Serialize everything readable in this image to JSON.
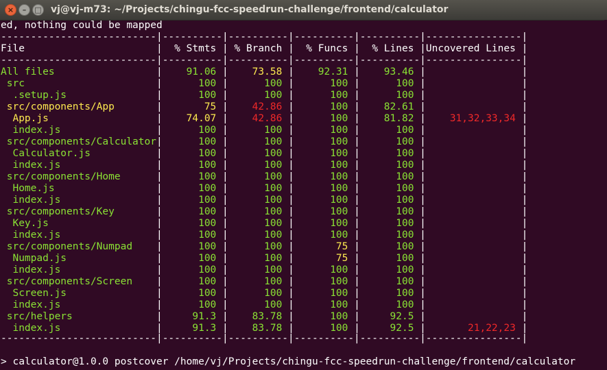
{
  "window": {
    "title": "vj@vj-m73: ~/Projects/chingu-fcc-speedrun-challenge/frontend/calculator",
    "buttons": {
      "close": "×",
      "minimize": "–",
      "maximize": "□"
    }
  },
  "colors": {
    "background": "#300a24",
    "green": "#8ae234",
    "yellow": "#fce94f",
    "red": "#ef2929",
    "text": "#ffffff"
  },
  "terminal": {
    "top_line": "ed, nothing could be mapped",
    "separator": "--------------------------|----------|----------|----------|----------|----------------|",
    "separator_bottom": "--------------------------|----------|----------|----------|----------|----------------|",
    "header": {
      "file": "File",
      "stmts": "% Stmts",
      "branch": "% Branch",
      "funcs": "% Funcs",
      "lines": "% Lines",
      "uncovered": "Uncovered Lines"
    },
    "rows": [
      {
        "indent": 0,
        "file": "All files",
        "stmts": "91.06",
        "branch": "73.58",
        "funcs": "92.31",
        "lines": "93.46",
        "uncovered": "",
        "c": [
          "g",
          "g",
          "y",
          "g",
          "g",
          "r"
        ]
      },
      {
        "indent": 1,
        "file": "src",
        "stmts": "100",
        "branch": "100",
        "funcs": "100",
        "lines": "100",
        "uncovered": "",
        "c": [
          "g",
          "g",
          "g",
          "g",
          "g",
          "r"
        ]
      },
      {
        "indent": 2,
        "file": ".setup.js",
        "stmts": "100",
        "branch": "100",
        "funcs": "100",
        "lines": "100",
        "uncovered": "",
        "c": [
          "g",
          "g",
          "g",
          "g",
          "g",
          "r"
        ]
      },
      {
        "indent": 1,
        "file": "src/components/App",
        "stmts": "75",
        "branch": "42.86",
        "funcs": "100",
        "lines": "82.61",
        "uncovered": "",
        "c": [
          "y",
          "y",
          "r",
          "g",
          "g",
          "r"
        ]
      },
      {
        "indent": 2,
        "file": "App.js",
        "stmts": "74.07",
        "branch": "42.86",
        "funcs": "100",
        "lines": "81.82",
        "uncovered": "31,32,33,34",
        "c": [
          "y",
          "y",
          "r",
          "g",
          "g",
          "r"
        ]
      },
      {
        "indent": 2,
        "file": "index.js",
        "stmts": "100",
        "branch": "100",
        "funcs": "100",
        "lines": "100",
        "uncovered": "",
        "c": [
          "g",
          "g",
          "g",
          "g",
          "g",
          "r"
        ]
      },
      {
        "indent": 1,
        "file": "src/components/Calculator",
        "stmts": "100",
        "branch": "100",
        "funcs": "100",
        "lines": "100",
        "uncovered": "",
        "c": [
          "g",
          "g",
          "g",
          "g",
          "g",
          "r"
        ]
      },
      {
        "indent": 2,
        "file": "Calculator.js",
        "stmts": "100",
        "branch": "100",
        "funcs": "100",
        "lines": "100",
        "uncovered": "",
        "c": [
          "g",
          "g",
          "g",
          "g",
          "g",
          "r"
        ]
      },
      {
        "indent": 2,
        "file": "index.js",
        "stmts": "100",
        "branch": "100",
        "funcs": "100",
        "lines": "100",
        "uncovered": "",
        "c": [
          "g",
          "g",
          "g",
          "g",
          "g",
          "r"
        ]
      },
      {
        "indent": 1,
        "file": "src/components/Home",
        "stmts": "100",
        "branch": "100",
        "funcs": "100",
        "lines": "100",
        "uncovered": "",
        "c": [
          "g",
          "g",
          "g",
          "g",
          "g",
          "r"
        ]
      },
      {
        "indent": 2,
        "file": "Home.js",
        "stmts": "100",
        "branch": "100",
        "funcs": "100",
        "lines": "100",
        "uncovered": "",
        "c": [
          "g",
          "g",
          "g",
          "g",
          "g",
          "r"
        ]
      },
      {
        "indent": 2,
        "file": "index.js",
        "stmts": "100",
        "branch": "100",
        "funcs": "100",
        "lines": "100",
        "uncovered": "",
        "c": [
          "g",
          "g",
          "g",
          "g",
          "g",
          "r"
        ]
      },
      {
        "indent": 1,
        "file": "src/components/Key",
        "stmts": "100",
        "branch": "100",
        "funcs": "100",
        "lines": "100",
        "uncovered": "",
        "c": [
          "g",
          "g",
          "g",
          "g",
          "g",
          "r"
        ]
      },
      {
        "indent": 2,
        "file": "Key.js",
        "stmts": "100",
        "branch": "100",
        "funcs": "100",
        "lines": "100",
        "uncovered": "",
        "c": [
          "g",
          "g",
          "g",
          "g",
          "g",
          "r"
        ]
      },
      {
        "indent": 2,
        "file": "index.js",
        "stmts": "100",
        "branch": "100",
        "funcs": "100",
        "lines": "100",
        "uncovered": "",
        "c": [
          "g",
          "g",
          "g",
          "g",
          "g",
          "r"
        ]
      },
      {
        "indent": 1,
        "file": "src/components/Numpad",
        "stmts": "100",
        "branch": "100",
        "funcs": "75",
        "lines": "100",
        "uncovered": "",
        "c": [
          "g",
          "g",
          "g",
          "y",
          "g",
          "r"
        ]
      },
      {
        "indent": 2,
        "file": "Numpad.js",
        "stmts": "100",
        "branch": "100",
        "funcs": "75",
        "lines": "100",
        "uncovered": "",
        "c": [
          "g",
          "g",
          "g",
          "y",
          "g",
          "r"
        ]
      },
      {
        "indent": 2,
        "file": "index.js",
        "stmts": "100",
        "branch": "100",
        "funcs": "100",
        "lines": "100",
        "uncovered": "",
        "c": [
          "g",
          "g",
          "g",
          "g",
          "g",
          "r"
        ]
      },
      {
        "indent": 1,
        "file": "src/components/Screen",
        "stmts": "100",
        "branch": "100",
        "funcs": "100",
        "lines": "100",
        "uncovered": "",
        "c": [
          "g",
          "g",
          "g",
          "g",
          "g",
          "r"
        ]
      },
      {
        "indent": 2,
        "file": "Screen.js",
        "stmts": "100",
        "branch": "100",
        "funcs": "100",
        "lines": "100",
        "uncovered": "",
        "c": [
          "g",
          "g",
          "g",
          "g",
          "g",
          "r"
        ]
      },
      {
        "indent": 2,
        "file": "index.js",
        "stmts": "100",
        "branch": "100",
        "funcs": "100",
        "lines": "100",
        "uncovered": "",
        "c": [
          "g",
          "g",
          "g",
          "g",
          "g",
          "r"
        ]
      },
      {
        "indent": 1,
        "file": "src/helpers",
        "stmts": "91.3",
        "branch": "83.78",
        "funcs": "100",
        "lines": "92.5",
        "uncovered": "",
        "c": [
          "g",
          "g",
          "g",
          "g",
          "g",
          "r"
        ]
      },
      {
        "indent": 2,
        "file": "index.js",
        "stmts": "91.3",
        "branch": "83.78",
        "funcs": "100",
        "lines": "92.5",
        "uncovered": "21,22,23",
        "c": [
          "g",
          "g",
          "g",
          "g",
          "g",
          "r"
        ]
      }
    ],
    "prompt_line": "> calculator@1.0.0 postcover /home/vj/Projects/chingu-fcc-speedrun-challenge/frontend/calculator"
  }
}
